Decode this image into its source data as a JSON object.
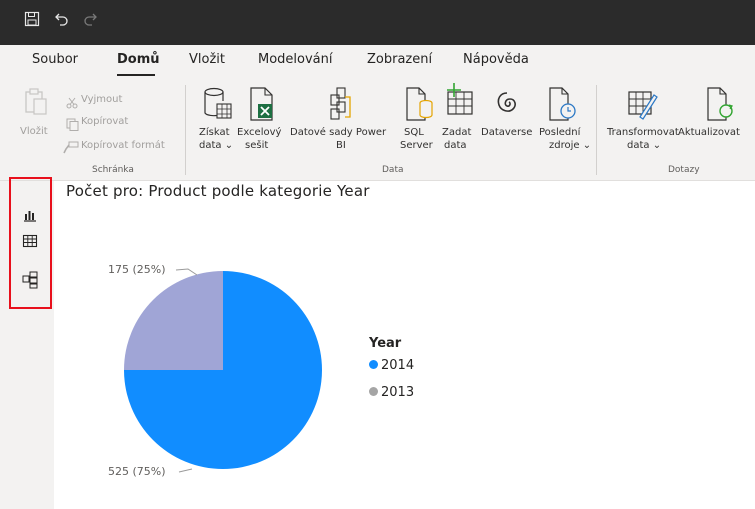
{
  "menu": {
    "items": [
      {
        "label": "Soubor"
      },
      {
        "label": "Domů"
      },
      {
        "label": "Vložit"
      },
      {
        "label": "Modelování"
      },
      {
        "label": "Zobrazení"
      },
      {
        "label": "Nápověda"
      }
    ]
  },
  "ribbon": {
    "clipboard": {
      "paste_label": "Vložit",
      "cut_label": "Vyjmout",
      "copy_label": "Kopírovat",
      "format_painter_label": "Kopírovat formát",
      "group_label": "Schránka"
    },
    "data": {
      "get_data": [
        "Získat",
        "data ⌄"
      ],
      "excel": [
        "Excelový",
        "sešit"
      ],
      "datasets": [
        "Datové sady Power",
        "BI"
      ],
      "sql": [
        "SQL",
        "Server"
      ],
      "enter_data": [
        "Zadat",
        "data"
      ],
      "dataverse": [
        "Dataverse"
      ],
      "recent": [
        "Poslední",
        "zdroje ⌄"
      ],
      "group_label": "Data"
    },
    "queries": {
      "transform": [
        "Transformovat",
        "data ⌄"
      ],
      "refresh": [
        "Aktualizovat"
      ],
      "group_label": "Dotazy"
    }
  },
  "colors": {
    "slice_2014": "#118DFF",
    "slice_2013": "#A0A5D6",
    "legend_2013": "#A5A5A5",
    "highlight_box": "#E8101C"
  },
  "chart_data": {
    "type": "pie",
    "title": "Počet pro: Product podle kategorie Year",
    "legend_title": "Year",
    "legend_position": "right",
    "slices": [
      {
        "label": "2014",
        "value": 525,
        "percent": 75,
        "data_label": "525 (75%)"
      },
      {
        "label": "2013",
        "value": 175,
        "percent": 25,
        "data_label": "175 (25%)"
      }
    ]
  }
}
